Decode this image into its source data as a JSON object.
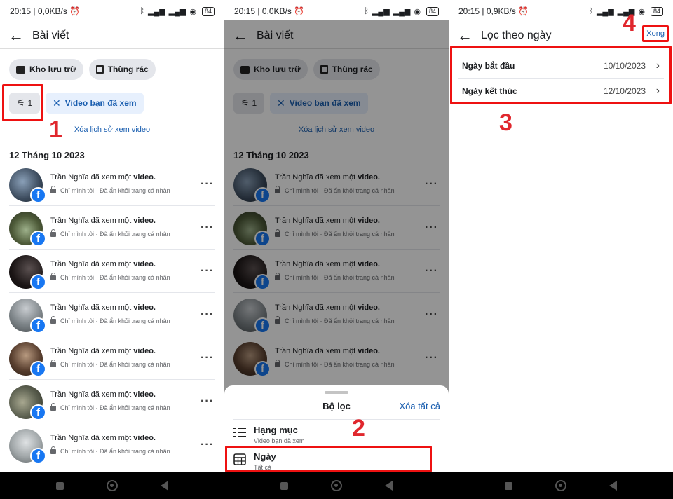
{
  "panel1": {
    "status": {
      "time": "20:15 | 0,0KB/s ⏰",
      "battery": "84"
    },
    "header": {
      "title": "Bài viết"
    },
    "chips": {
      "archive": "Kho lưu trữ",
      "trash": "Thùng rác"
    },
    "filter": {
      "count": "1",
      "chip_label": "Video bạn đã xem"
    },
    "clear_history": "Xóa lịch sử xem video",
    "date_header": "12 Tháng 10 2023",
    "items": [
      {
        "title_name": "Trần Nghĩa",
        "title_rest": " đã xem một ",
        "title_obj": "video.",
        "sub": "Chỉ mình tôi · Đã ẩn khỏi trang cá nhân"
      },
      {
        "title_name": "Trần Nghĩa",
        "title_rest": " đã xem một ",
        "title_obj": "video.",
        "sub": "Chỉ mình tôi · Đã ẩn khỏi trang cá nhân"
      },
      {
        "title_name": "Trần Nghĩa",
        "title_rest": " đã xem một ",
        "title_obj": "video.",
        "sub": "Chỉ mình tôi · Đã ẩn khỏi trang cá nhân"
      },
      {
        "title_name": "Trần Nghĩa",
        "title_rest": " đã xem một ",
        "title_obj": "video.",
        "sub": "Chỉ mình tôi · Đã ẩn khỏi trang cá nhân"
      },
      {
        "title_name": "Trần Nghĩa",
        "title_rest": " đã xem một ",
        "title_obj": "video.",
        "sub": "Chỉ mình tôi · Đã ẩn khỏi trang cá nhân"
      },
      {
        "title_name": "Trần Nghĩa",
        "title_rest": " đã xem một ",
        "title_obj": "video.",
        "sub": "Chỉ mình tôi · Đã ẩn khỏi trang cá nhân"
      },
      {
        "title_name": "Trần Nghĩa",
        "title_rest": " đã xem một ",
        "title_obj": "video.",
        "sub": "Chỉ mình tôi · Đã ẩn khỏi trang cá nhân"
      }
    ],
    "step_number": "1"
  },
  "panel2": {
    "status": {
      "time": "20:15 | 0,0KB/s ⏰",
      "battery": "84"
    },
    "sheet": {
      "title": "Bộ lọc",
      "clear_all": "Xóa tất cả",
      "category": {
        "label": "Hạng mục",
        "value": "Video bạn đã xem"
      },
      "date": {
        "label": "Ngày",
        "value": "Tất cả"
      }
    },
    "step_number": "2"
  },
  "panel3": {
    "status": {
      "time": "20:15 | 0,9KB/s ⏰",
      "battery": "84"
    },
    "header": {
      "title": "Lọc theo ngày",
      "done": "Xong"
    },
    "start": {
      "label": "Ngày bắt đầu",
      "value": "10/10/2023"
    },
    "end": {
      "label": "Ngày kết thúc",
      "value": "12/10/2023"
    },
    "step_number_3": "3",
    "step_number_4": "4"
  },
  "colors": {
    "accent": "#1b5fb0",
    "facebook": "#1877f2",
    "highlight": "#e11111"
  }
}
